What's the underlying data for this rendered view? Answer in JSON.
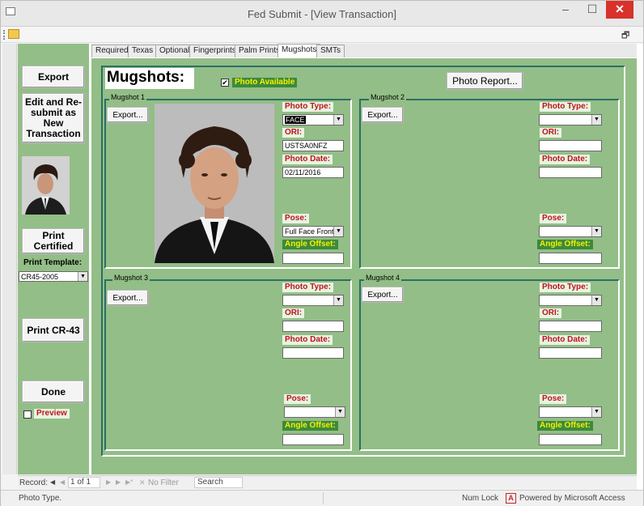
{
  "window": {
    "title": "Fed Submit - [View Transaction]",
    "minimize": "–",
    "maximize": "☐",
    "close": "✕",
    "restore": "🗗"
  },
  "tabs": [
    "Required",
    "Texas",
    "Optional",
    "Fingerprints",
    "Palm Prints",
    "Mugshots",
    "SMTs"
  ],
  "active_tab": "Mugshots",
  "left": {
    "export": "Export",
    "edit_resubmit": "Edit and Re-submit as New Transaction",
    "print_certified": "Print Certified",
    "print_template_label": "Print Template:",
    "print_template_value": "CR45-2005",
    "print_cr43": "Print CR-43",
    "done": "Done",
    "preview": "Preview"
  },
  "main": {
    "heading": "Mugshots:",
    "photo_available": "Photo Available",
    "photo_report": "Photo Report..."
  },
  "mugshots": [
    {
      "title": "Mugshot 1",
      "export": "Export...",
      "photo_type_label": "Photo Type:",
      "photo_type": "FACE",
      "ori_label": "ORI:",
      "ori": "USTSA0NFZ",
      "date_label": "Photo Date:",
      "date": "02/11/2016",
      "pose_label": "Pose:",
      "pose": "Full Face Front",
      "angle_label": "Angle Offset:",
      "angle": ""
    },
    {
      "title": "Mugshot 2",
      "export": "Export...",
      "photo_type_label": "Photo Type:",
      "photo_type": "",
      "ori_label": "ORI:",
      "ori": "",
      "date_label": "Photo Date:",
      "date": "",
      "pose_label": "Pose:",
      "pose": "",
      "angle_label": "Angle Offset:",
      "angle": ""
    },
    {
      "title": "Mugshot 3",
      "export": "Export...",
      "photo_type_label": "Photo Type:",
      "photo_type": "",
      "ori_label": "ORI:",
      "ori": "",
      "date_label": "Photo Date:",
      "date": "",
      "pose_label": "Pose:",
      "pose": "",
      "angle_label": "Angle Offset:",
      "angle": ""
    },
    {
      "title": "Mugshot 4",
      "export": "Export...",
      "photo_type_label": "Photo Type:",
      "photo_type": "",
      "ori_label": "ORI:",
      "ori": "",
      "date_label": "Photo Date:",
      "date": "",
      "pose_label": "Pose:",
      "pose": "",
      "angle_label": "Angle Offset:",
      "angle": ""
    }
  ],
  "record_nav": {
    "label": "Record:",
    "first": "◀",
    "prev": "◀",
    "position": "1 of 1",
    "next": "▶",
    "last": "▶",
    "new": "▶*",
    "filter": "No Filter",
    "search": "Search"
  },
  "status": {
    "left": "Photo Type.",
    "num_lock": "Num Lock",
    "powered": "Powered by Microsoft Access"
  }
}
